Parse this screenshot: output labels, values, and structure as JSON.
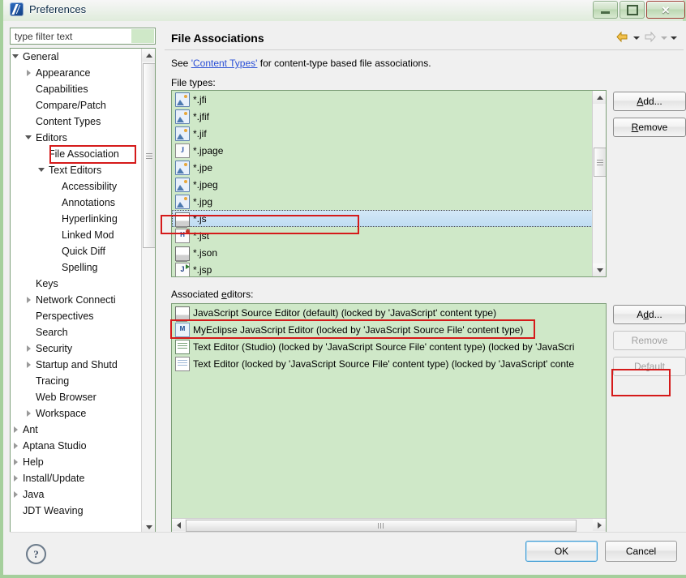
{
  "window": {
    "title": "Preferences",
    "app_icon": "eclipse-icon",
    "buttons": {
      "minimize": "minimize-icon",
      "maximize": "maximize-icon",
      "close": "close-icon"
    }
  },
  "sidebar": {
    "filter": {
      "placeholder": "type filter text",
      "value": ""
    },
    "items": [
      {
        "label": "General",
        "indent": 0,
        "twisty": "expanded",
        "selected": false
      },
      {
        "label": "Appearance",
        "indent": 1,
        "twisty": "collapsed",
        "selected": false
      },
      {
        "label": "Capabilities",
        "indent": 1,
        "twisty": "none",
        "selected": false
      },
      {
        "label": "Compare/Patch",
        "indent": 1,
        "twisty": "none",
        "selected": false
      },
      {
        "label": "Content Types",
        "indent": 1,
        "twisty": "none",
        "selected": false
      },
      {
        "label": "Editors",
        "indent": 1,
        "twisty": "expanded",
        "selected": false
      },
      {
        "label": "File Association",
        "indent": 2,
        "twisty": "none",
        "selected": true
      },
      {
        "label": "Text Editors",
        "indent": 2,
        "twisty": "expanded",
        "selected": false
      },
      {
        "label": "Accessibility",
        "indent": 3,
        "twisty": "none",
        "selected": false
      },
      {
        "label": "Annotations",
        "indent": 3,
        "twisty": "none",
        "selected": false
      },
      {
        "label": "Hyperlinking",
        "indent": 3,
        "twisty": "none",
        "selected": false
      },
      {
        "label": "Linked Mod",
        "indent": 3,
        "twisty": "none",
        "selected": false
      },
      {
        "label": "Quick Diff",
        "indent": 3,
        "twisty": "none",
        "selected": false
      },
      {
        "label": "Spelling",
        "indent": 3,
        "twisty": "none",
        "selected": false
      },
      {
        "label": "Keys",
        "indent": 1,
        "twisty": "none",
        "selected": false
      },
      {
        "label": "Network Connecti",
        "indent": 1,
        "twisty": "collapsed",
        "selected": false
      },
      {
        "label": "Perspectives",
        "indent": 1,
        "twisty": "none",
        "selected": false
      },
      {
        "label": "Search",
        "indent": 1,
        "twisty": "none",
        "selected": false
      },
      {
        "label": "Security",
        "indent": 1,
        "twisty": "collapsed",
        "selected": false
      },
      {
        "label": "Startup and Shutd",
        "indent": 1,
        "twisty": "collapsed",
        "selected": false
      },
      {
        "label": "Tracing",
        "indent": 1,
        "twisty": "none",
        "selected": false
      },
      {
        "label": "Web Browser",
        "indent": 1,
        "twisty": "none",
        "selected": false
      },
      {
        "label": "Workspace",
        "indent": 1,
        "twisty": "collapsed",
        "selected": false
      },
      {
        "label": "Ant",
        "indent": 0,
        "twisty": "collapsed",
        "selected": false
      },
      {
        "label": "Aptana Studio",
        "indent": 0,
        "twisty": "collapsed",
        "selected": false
      },
      {
        "label": "Help",
        "indent": 0,
        "twisty": "collapsed",
        "selected": false
      },
      {
        "label": "Install/Update",
        "indent": 0,
        "twisty": "collapsed",
        "selected": false
      },
      {
        "label": "Java",
        "indent": 0,
        "twisty": "collapsed",
        "selected": false
      },
      {
        "label": "JDT Weaving",
        "indent": 0,
        "twisty": "none",
        "selected": false
      }
    ]
  },
  "page": {
    "title": "File Associations",
    "nav": {
      "back": "back-arrow-icon",
      "back_menu": "chevron-down-icon",
      "forward": "forward-arrow-icon",
      "forward_menu": "chevron-down-icon",
      "view_menu": "chevron-down-icon"
    },
    "description": {
      "prefix": "See ",
      "link": "'Content Types'",
      "suffix": " for content-type based file associations."
    },
    "file_types_label": "File types:",
    "associated_editors_label_prefix": "Associated ",
    "associated_editors_label_mnemonic": "e",
    "associated_editors_label_suffix": "ditors:",
    "file_types": [
      {
        "name": "*.jfi",
        "icon": "image-file-icon",
        "selected": false
      },
      {
        "name": "*.jfif",
        "icon": "image-file-icon",
        "selected": false
      },
      {
        "name": "*.jif",
        "icon": "image-file-icon",
        "selected": false
      },
      {
        "name": "*.jpage",
        "icon": "java-page-icon",
        "selected": false
      },
      {
        "name": "*.jpe",
        "icon": "image-file-icon",
        "selected": false
      },
      {
        "name": "*.jpeg",
        "icon": "image-file-icon",
        "selected": false
      },
      {
        "name": "*.jpg",
        "icon": "image-file-icon",
        "selected": false
      },
      {
        "name": "*.js",
        "icon": "javascript-file-icon",
        "selected": true
      },
      {
        "name": "*.jst",
        "icon": "html-file-icon",
        "selected": false
      },
      {
        "name": "*.json",
        "icon": "json-file-icon",
        "selected": false
      },
      {
        "name": "*.jsp",
        "icon": "jsp-file-icon",
        "selected": false
      }
    ],
    "associated_editors": [
      {
        "name": "JavaScript Source Editor (default) (locked by 'JavaScript' content type)",
        "icon": "javascript-editor-icon",
        "highlighted": true
      },
      {
        "name": "MyEclipse JavaScript Editor (locked by 'JavaScript Source File' content type)",
        "icon": "myeclipse-editor-icon",
        "highlighted": false
      },
      {
        "name": "Text Editor (Studio) (locked by 'JavaScript Source File' content type) (locked by 'JavaScri",
        "icon": "text-editor-studio-icon",
        "highlighted": false
      },
      {
        "name": "Text Editor (locked by 'JavaScript Source File' content type) (locked by 'JavaScript' conte",
        "icon": "text-editor-icon",
        "highlighted": false
      }
    ],
    "buttons": {
      "add_file_type": "Add...",
      "remove_file_type": "Remove",
      "add_editor": "Add...",
      "remove_editor": "Remove",
      "default_editor": "Default"
    }
  },
  "footer": {
    "help": "?",
    "ok": "OK",
    "cancel": "Cancel"
  },
  "colors": {
    "window_border": "#a5cf9c",
    "list_background": "#cfe8c8",
    "selection": "#bfdcf2",
    "annotation": "#d51a1a",
    "link": "#2a4fd6"
  }
}
